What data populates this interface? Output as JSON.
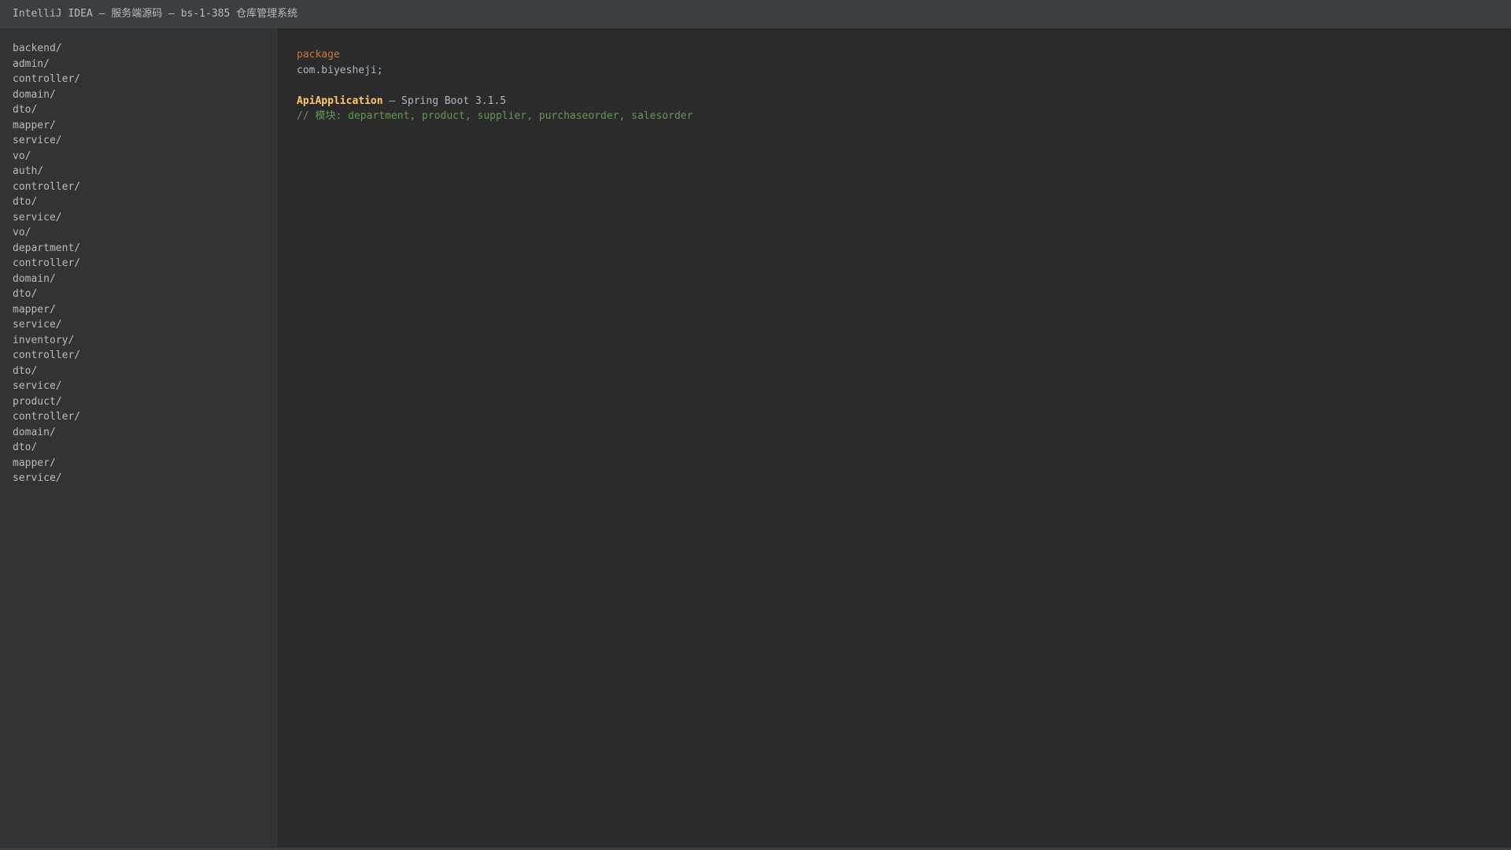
{
  "window": {
    "title": "IntelliJ IDEA — 服务端源码 — bs-1-385 仓库管理系统"
  },
  "project_tree": {
    "items": [
      "backend/",
      "admin/",
      "controller/",
      "domain/",
      "dto/",
      "mapper/",
      "service/",
      "vo/",
      "auth/",
      "controller/",
      "dto/",
      "service/",
      "vo/",
      "department/",
      "controller/",
      "domain/",
      "dto/",
      "mapper/",
      "service/",
      "inventory/",
      "controller/",
      "dto/",
      "service/",
      "product/",
      "controller/",
      "domain/",
      "dto/",
      "mapper/",
      "service/"
    ]
  },
  "editor": {
    "package_keyword": "package",
    "package_name": "com.biyesheji;",
    "class_name": "ApiApplication",
    "class_suffix": " — Spring Boot 3.1.5",
    "comment": "// 模块: department, product, supplier, purchaseorder, salesorder"
  }
}
